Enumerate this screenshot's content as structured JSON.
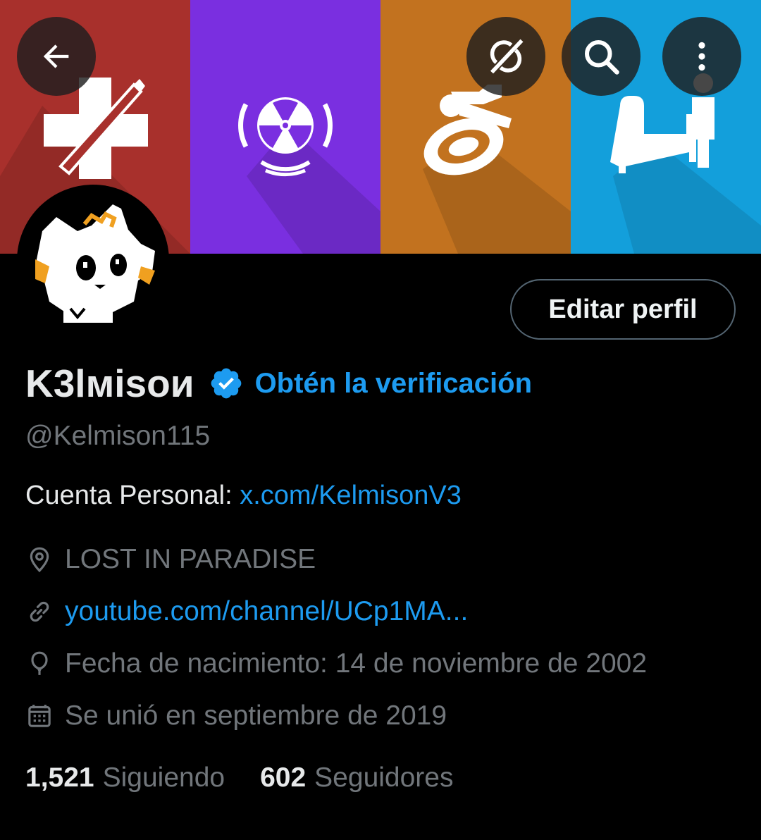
{
  "colors": {
    "accent": "#1d9bf0",
    "background": "#000000",
    "secondary_text": "#71767b",
    "banner_panels": [
      "#a8302c",
      "#7a2fe0",
      "#c2721f",
      "#139fdb"
    ]
  },
  "header": {
    "banner_icons": [
      "medic-ammo-icon",
      "radiation-icon",
      "wheelchair-icon",
      "bed-person-icon"
    ],
    "buttons": [
      "back-arrow-icon",
      "grok-icon",
      "search-icon",
      "more-vertical-icon"
    ]
  },
  "profile": {
    "edit_label": "Editar perfil",
    "display_name": "K3lмisои",
    "verification_cta": "Obtén la verificación",
    "handle": "@Kelmison115",
    "bio_prefix": "Cuenta Personal: ",
    "bio_link": "x.com/KelmisonV3",
    "location": "LOST IN PARADISE",
    "website": "youtube.com/channel/UCp1MA...",
    "birth": "Fecha de nacimiento: 14 de noviembre de 2002",
    "joined": "Se unió en septiembre de 2019"
  },
  "stats": {
    "following_count": "1,521",
    "following_label": "Siguiendo",
    "followers_count": "602",
    "followers_label": "Seguidores"
  }
}
